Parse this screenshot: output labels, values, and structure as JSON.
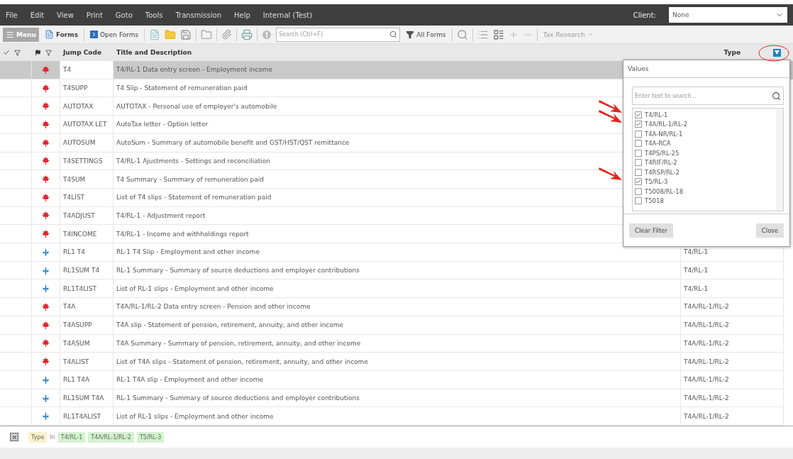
{
  "menu": [
    "File",
    "Edit",
    "View",
    "Print",
    "Goto",
    "Tools",
    "Transmission",
    "Help",
    "Internal (Test)"
  ],
  "client": {
    "label": "Client:",
    "value": "None"
  },
  "toolbar": {
    "menu": "Menu",
    "forms": "Forms",
    "open_forms": "Open Forms",
    "search_placeholder": "Search (Ctrl+F)",
    "all_forms": "All Forms",
    "tax_research": "Tax Research"
  },
  "table": {
    "columns": [
      "Jump Code",
      "Title and Description",
      "Type"
    ],
    "rows": [
      {
        "kind": "canada",
        "code": "T4",
        "title": "T4/RL-1 Data entry screen - Employment income",
        "selected": true
      },
      {
        "kind": "canada",
        "code": "T4SUPP",
        "title": "T4 Slip - Statement of remuneration paid",
        "selected": false
      },
      {
        "kind": "canada",
        "code": "AUTOTAX",
        "title": "AUTOTAX - Personal use of employer's automobile",
        "selected": false
      },
      {
        "kind": "canada",
        "code": "AUTOTAX LET",
        "title": "AutoTax letter - Option letter",
        "selected": false
      },
      {
        "kind": "canada",
        "code": "AUTOSUM",
        "title": "AutoSum - Summary of automobile benefit and GST/HST/QST remittance",
        "selected": false
      },
      {
        "kind": "canada",
        "code": "T4SETTINGS",
        "title": "T4/RL-1 Ajustments - Settings and reconciliation",
        "selected": false
      },
      {
        "kind": "canada",
        "code": "T4SUM",
        "title": "T4 Summary - Summary of remuneration paid",
        "selected": false
      },
      {
        "kind": "canada",
        "code": "T4LIST",
        "title": "List of T4 slips - Statement of remuneration paid",
        "selected": false
      },
      {
        "kind": "canada",
        "code": "T4ADJUST",
        "title": "T4/RL-1 - Adjustment report",
        "selected": false
      },
      {
        "kind": "canada",
        "code": "T4INCOME",
        "title": "T4/RL-1 - Income and withholdings report",
        "selected": false
      },
      {
        "kind": "quebec",
        "code": "RL1 T4",
        "title": "RL-1 T4 Slip - Employment and other income",
        "type": "T4/RL-1",
        "selected": false
      },
      {
        "kind": "quebec",
        "code": "RL1SUM T4",
        "title": "RL-1 Summary - Summary of source deductions and employer contributions",
        "type": "T4/RL-1",
        "selected": false
      },
      {
        "kind": "quebec",
        "code": "RL1T4LIST",
        "title": "List of RL-1 slips - Employment and other income",
        "type": "T4/RL-1",
        "selected": false
      },
      {
        "kind": "canada",
        "code": "T4A",
        "title": "T4A/RL-1/RL-2 Data entry screen - Pension and other income",
        "type": "T4A/RL-1/RL-2",
        "selected": false
      },
      {
        "kind": "canada",
        "code": "T4ASUPP",
        "title": "T4A slip - Statement of pension, retirement, annuity, and other income",
        "type": "T4A/RL-1/RL-2",
        "selected": false
      },
      {
        "kind": "canada",
        "code": "T4ASUM",
        "title": "T4A Summary - Summary of pension, retirement, annuity, and other income",
        "type": "T4A/RL-1/RL-2",
        "selected": false
      },
      {
        "kind": "canada",
        "code": "T4ALIST",
        "title": "List of T4A slips - Statement of pension, retirement, annuity, and other income",
        "type": "T4A/RL-1/RL-2",
        "selected": false
      },
      {
        "kind": "quebec",
        "code": "RL1 T4A",
        "title": "RL-1 T4A slip - Employment and other income",
        "type": "T4A/RL-1/RL-2",
        "selected": false
      },
      {
        "kind": "quebec",
        "code": "RL1SUM T4A",
        "title": "RL-1 Summary - Summary of source deductions and employer contributions",
        "type": "T4A/RL-1/RL-2",
        "selected": false
      },
      {
        "kind": "quebec",
        "code": "RL1T4ALIST",
        "title": "List of RL-1 slips - Employment and other income",
        "type": "T4A/RL-1/RL-2",
        "selected": false
      }
    ]
  },
  "filter_popup": {
    "tab": "Values",
    "search_placeholder": "Enter text to search...",
    "values": [
      {
        "label": "T4/RL-1",
        "checked": true,
        "arrow": true
      },
      {
        "label": "T4A/RL-1/RL-2",
        "checked": true,
        "arrow": true
      },
      {
        "label": "T4A-NR/RL-1",
        "checked": false,
        "arrow": false
      },
      {
        "label": "T4A-RCA",
        "checked": false,
        "arrow": false
      },
      {
        "label": "T4PS/RL-25",
        "checked": false,
        "arrow": false
      },
      {
        "label": "T4RIF/RL-2",
        "checked": false,
        "arrow": false
      },
      {
        "label": "T4RSP/RL-2",
        "checked": false,
        "arrow": false
      },
      {
        "label": "T5/RL-3",
        "checked": true,
        "arrow": true
      },
      {
        "label": "T5008/RL-18",
        "checked": false,
        "arrow": false
      },
      {
        "label": "T5018",
        "checked": false,
        "arrow": false
      }
    ],
    "clear": "Clear Filter",
    "close": "Close"
  },
  "filter_bar": {
    "field": "Type",
    "operator": "In",
    "values": [
      "T4/RL-1",
      "T4A/RL-1/RL-2",
      "T5/RL-3"
    ]
  }
}
